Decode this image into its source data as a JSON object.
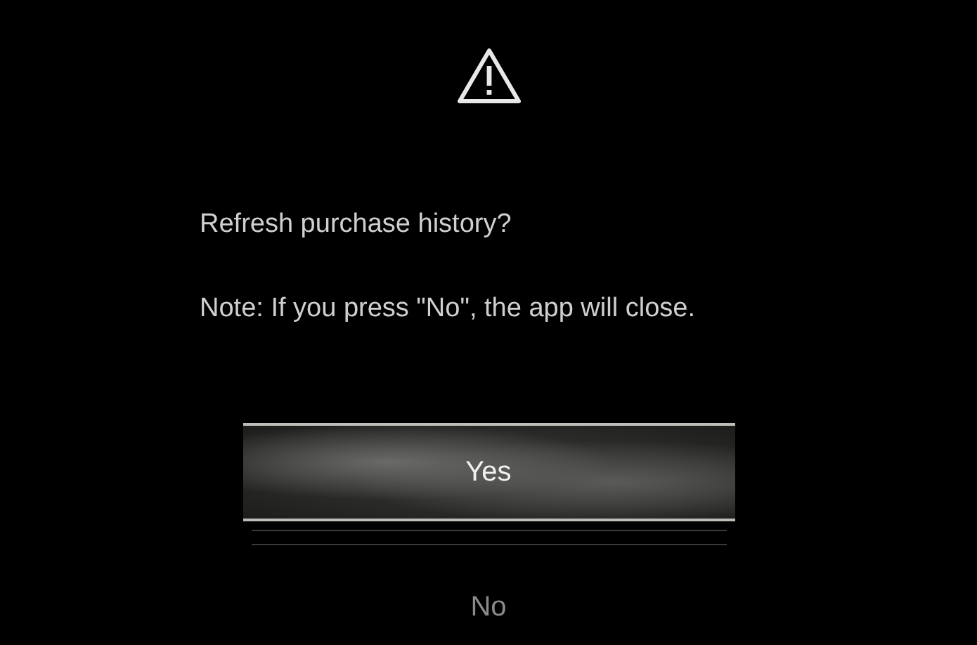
{
  "dialog": {
    "message": "Refresh purchase history?",
    "note": "Note: If you press \"No\", the app will close."
  },
  "buttons": [
    {
      "label": "Yes",
      "selected": true
    },
    {
      "label": "No",
      "selected": false
    }
  ]
}
